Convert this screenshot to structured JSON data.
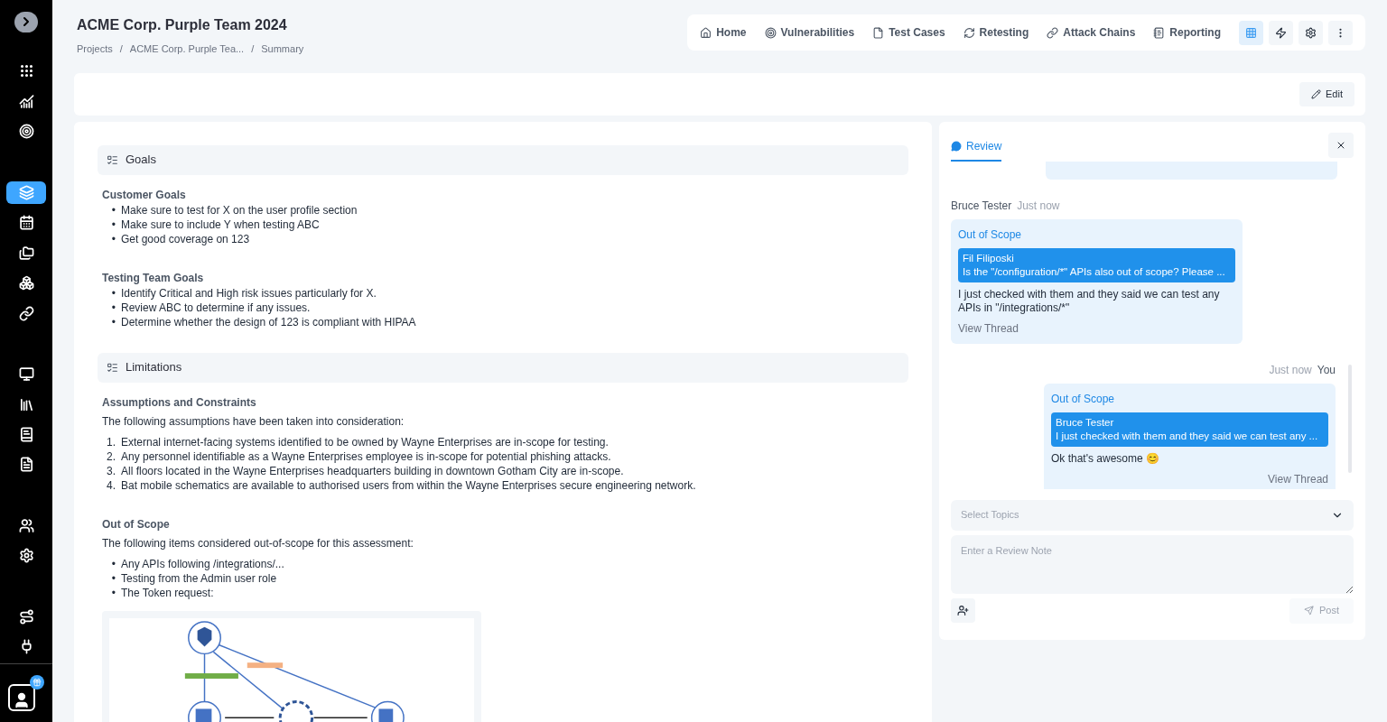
{
  "sidebar": {
    "items": [
      {
        "selected": false
      },
      {
        "selected": false
      },
      {
        "selected": false
      },
      {
        "selected": false
      },
      {
        "selected": true
      },
      {
        "selected": false
      },
      {
        "selected": false
      },
      {
        "selected": false
      },
      {
        "selected": false
      },
      {
        "selected": false
      },
      {
        "selected": false
      },
      {
        "selected": false
      },
      {
        "selected": false
      },
      {
        "selected": false
      },
      {
        "selected": false
      },
      {
        "selected": false
      },
      {
        "selected": false
      }
    ]
  },
  "header": {
    "title": "ACME Corp. Purple Team 2024",
    "breadcrumbs": [
      "Projects",
      "ACME Corp. Purple Tea...",
      "Summary"
    ],
    "separator": "/"
  },
  "nav": {
    "tabs": [
      "Home",
      "Vulnerabilities",
      "Test Cases",
      "Retesting",
      "Attack Chains",
      "Reporting"
    ],
    "tools": [
      {
        "selected": true
      },
      {
        "selected": false
      },
      {
        "selected": false
      },
      {
        "selected": false
      }
    ]
  },
  "edit_button": "Edit",
  "sections": [
    {
      "title": "Goals",
      "blocks": [
        {
          "heading": "Customer Goals",
          "items": [
            {
              "marker": "•",
              "text": "Make sure to test for X on the user profile section"
            },
            {
              "marker": "•",
              "text": "Make sure to include Y when testing ABC"
            },
            {
              "marker": "•",
              "text": "Get good coverage on 123"
            }
          ]
        },
        {
          "heading": "Testing Team Goals",
          "items": [
            {
              "marker": "•",
              "text": "Identify Critical and High risk issues particularly for X."
            },
            {
              "marker": "•",
              "text": "Review ABC to determine if any issues."
            },
            {
              "marker": "•",
              "text": "Determine whether the design of 123 is compliant with HIPAA"
            }
          ]
        }
      ]
    },
    {
      "title": "Limitations",
      "blocks": [
        {
          "heading": "Assumptions and Constraints",
          "intro": "The following assumptions have been taken into consideration:",
          "items": [
            {
              "marker": "1.",
              "text": "External internet-facing systems identified to be owned by Wayne Enterprises are in-scope for testing."
            },
            {
              "marker": "2.",
              "text": "Any personnel identifiable as a Wayne Enterprises employee is in-scope for potential phishing attacks."
            },
            {
              "marker": "3.",
              "text": "All floors located in the Wayne Enterprises headquarters building in downtown Gotham City are in-scope."
            },
            {
              "marker": "4.",
              "text": "Bat mobile schematics are available to authorised users from within the Wayne Enterprises secure engineering network."
            }
          ]
        },
        {
          "heading": "Out of Scope",
          "intro": "The following items considered out-of-scope for this assessment:",
          "items": [
            {
              "marker": "•",
              "text": "Any APIs following /integrations/..."
            },
            {
              "marker": "•",
              "text": "Testing from the Admin user role"
            },
            {
              "marker": "•",
              "text": "The Token request:"
            }
          ],
          "figure": {
            "kind": "picture"
          }
        }
      ]
    }
  ],
  "review": {
    "tab": "Review",
    "messages": [
      {
        "author": "Bruce Tester",
        "time": "Just now",
        "mine": false,
        "topic": "Out of Scope",
        "quote_author": "Fil Filiposki",
        "quote_text": "Is the \"/configuration/*\" APIs also out of scope? Please ...",
        "text": "I just checked with them and they said we can test any APIs in \"/integrations/*\"",
        "link": "View Thread"
      },
      {
        "author": "You",
        "time": "Just now",
        "mine": true,
        "topic": "Out of Scope",
        "quote_author": "Bruce Tester",
        "quote_text": "I just checked with them and they said we can test any ...",
        "text": "Ok that's awesome 😊",
        "link": "View Thread"
      }
    ],
    "topics_placeholder": "Select Topics",
    "note_placeholder": "Enter a Review Note",
    "post_button": "Post"
  }
}
